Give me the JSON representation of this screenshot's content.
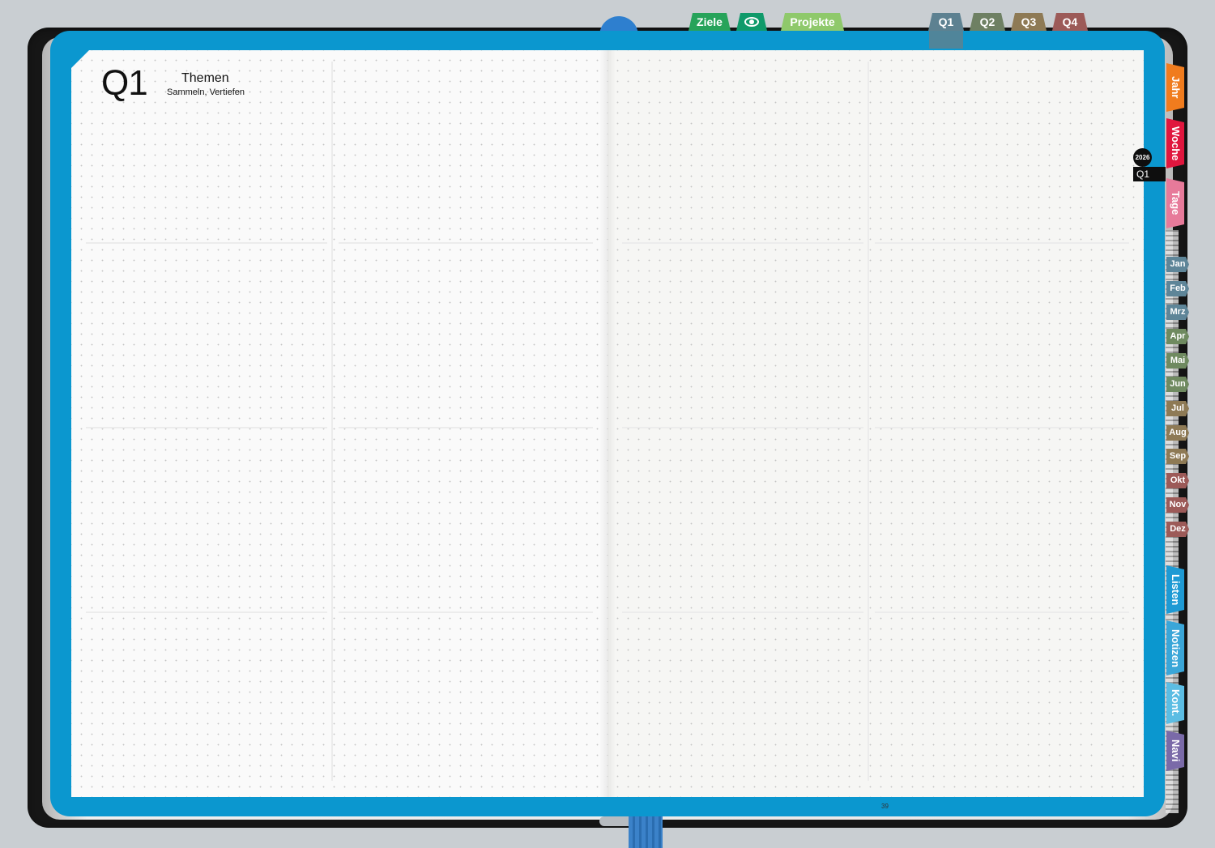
{
  "header": {
    "quarter_heading": "Q1",
    "section_title": "Themen",
    "section_subtitle": "Sammeln, Vertiefen"
  },
  "top_tabs": [
    {
      "label": "Ziele",
      "color": "#27a35a"
    },
    {
      "icon": "eye-icon",
      "color": "#0f9a6a"
    },
    {
      "label": "Projekte",
      "color": "#8fc96b"
    }
  ],
  "quarter_tabs": [
    {
      "label": "Q1",
      "color": "#5d8191"
    },
    {
      "label": "Q2",
      "color": "#6e8063"
    },
    {
      "label": "Q3",
      "color": "#8e7a55"
    },
    {
      "label": "Q4",
      "color": "#9c5a58"
    }
  ],
  "side_tabs": [
    {
      "label": "Jahr",
      "color": "#f07c1e"
    },
    {
      "label": "Woche",
      "color": "#e0163e"
    },
    {
      "label": "Tage",
      "color": "#e77a9a"
    }
  ],
  "month_tabs": [
    {
      "label": "Jan",
      "color": "#5e8598"
    },
    {
      "label": "Feb",
      "color": "#5e8598"
    },
    {
      "label": "Mrz",
      "color": "#5e8598"
    },
    {
      "label": "Apr",
      "color": "#6f8a60"
    },
    {
      "label": "Mai",
      "color": "#6f8a60"
    },
    {
      "label": "Jun",
      "color": "#6f8a60"
    },
    {
      "label": "Jul",
      "color": "#8e7a55"
    },
    {
      "label": "Aug",
      "color": "#8e7a55"
    },
    {
      "label": "Sep",
      "color": "#8e7a55"
    },
    {
      "label": "Okt",
      "color": "#9c5a58"
    },
    {
      "label": "Nov",
      "color": "#9c5a58"
    },
    {
      "label": "Dez",
      "color": "#9c5a58"
    }
  ],
  "bottom_side_tabs": [
    {
      "label": "Listen",
      "color": "#1e9ad4"
    },
    {
      "label": "Notizen",
      "color": "#3aa6d8"
    },
    {
      "label": "Kont.",
      "color": "#5cbde3"
    },
    {
      "label": "Navi",
      "color": "#7a6aa8"
    }
  ],
  "current": {
    "year": "2026",
    "quarter": "Q1"
  },
  "page_number": "39"
}
